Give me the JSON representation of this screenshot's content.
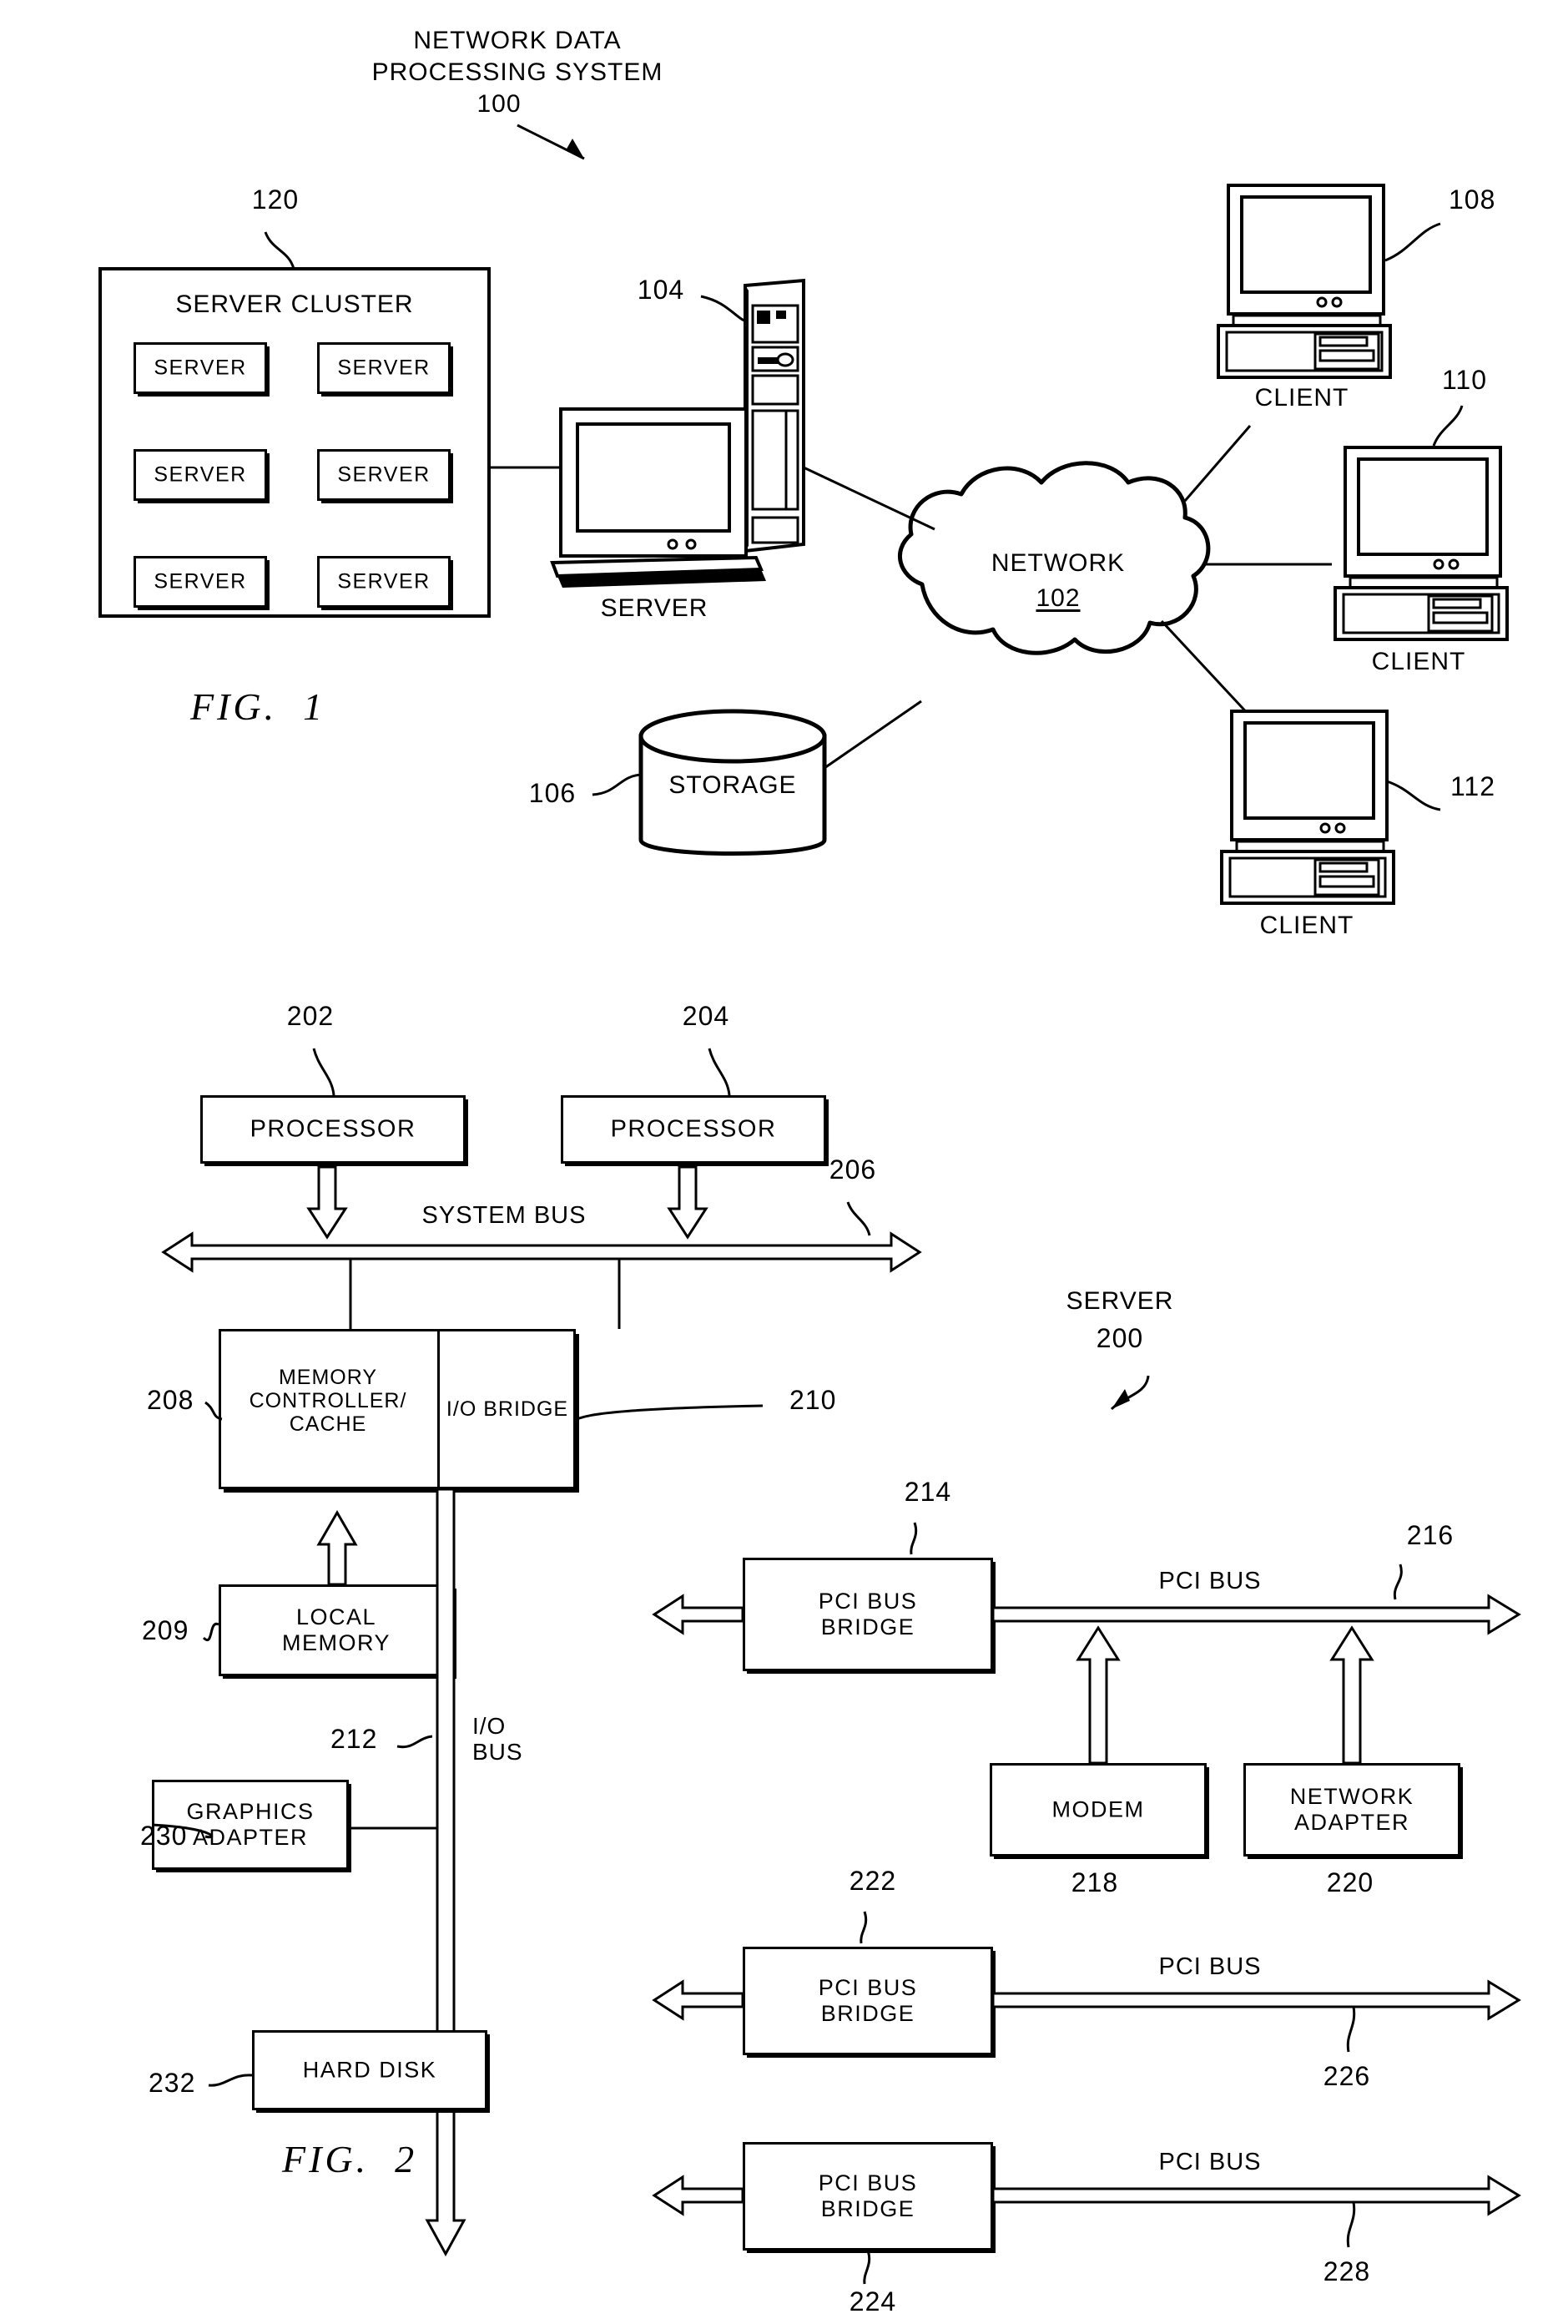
{
  "figure1": {
    "title_lines": [
      "NETWORK DATA",
      "PROCESSING SYSTEM"
    ],
    "title_ref": "100",
    "fig_label": "FIG.  1",
    "cluster": {
      "ref": "120",
      "title": "SERVER CLUSTER",
      "nodes": [
        "SERVER",
        "SERVER",
        "SERVER",
        "SERVER",
        "SERVER",
        "SERVER"
      ]
    },
    "server": {
      "ref": "104",
      "label": "SERVER"
    },
    "storage": {
      "ref": "106",
      "label": "STORAGE"
    },
    "network": {
      "label": "NETWORK",
      "ref": "102"
    },
    "clients": [
      {
        "ref": "108",
        "label": "CLIENT"
      },
      {
        "ref": "110",
        "label": "CLIENT"
      },
      {
        "ref": "112",
        "label": "CLIENT"
      }
    ]
  },
  "figure2": {
    "fig_label": "FIG.  2",
    "server_caption": "SERVER",
    "server_ref": "200",
    "processors": [
      {
        "ref": "202",
        "label": "PROCESSOR"
      },
      {
        "ref": "204",
        "label": "PROCESSOR"
      }
    ],
    "system_bus": {
      "label": "SYSTEM BUS",
      "ref": "206"
    },
    "memory_controller": {
      "ref": "208",
      "label": "MEMORY\nCONTROLLER/\nCACHE"
    },
    "io_bridge": {
      "ref": "210",
      "label": "I/O BRIDGE"
    },
    "local_memory": {
      "ref": "209",
      "label": "LOCAL\nMEMORY"
    },
    "io_bus": {
      "ref": "212",
      "label": "I/O\nBUS"
    },
    "graphics_adapter": {
      "ref": "230",
      "label": "GRAPHICS\nADAPTER"
    },
    "hard_disk": {
      "ref": "232",
      "label": "HARD DISK"
    },
    "pci_bridges": [
      {
        "ref": "214",
        "label": "PCI BUS\nBRIDGE"
      },
      {
        "ref": "222",
        "label": "PCI BUS\nBRIDGE"
      },
      {
        "ref": "224",
        "label": "PCI BUS\nBRIDGE"
      }
    ],
    "pci_buses": [
      {
        "ref": "216",
        "label": "PCI BUS"
      },
      {
        "ref": "226",
        "label": "PCI BUS"
      },
      {
        "ref": "228",
        "label": "PCI BUS"
      }
    ],
    "modem": {
      "ref": "218",
      "label": "MODEM"
    },
    "network_adapter": {
      "ref": "220",
      "label": "NETWORK\nADAPTER"
    }
  }
}
